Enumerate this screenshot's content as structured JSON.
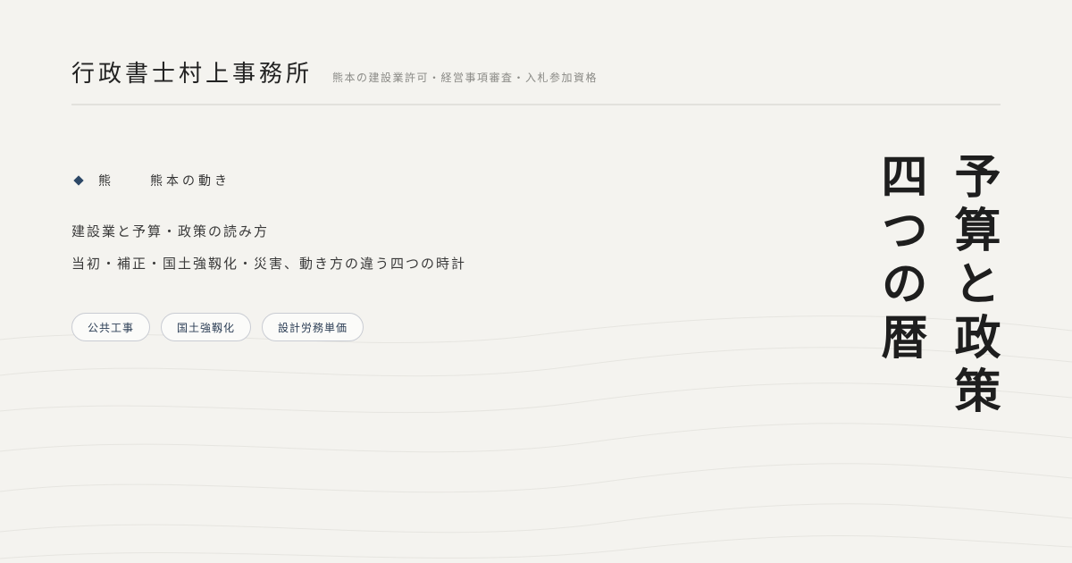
{
  "header": {
    "brand": "行政書士村上事務所",
    "tagline": "熊本の建設業許可・経営事項審査・入札参加資格"
  },
  "kicker": {
    "icon": "diamond-icon",
    "char": "熊",
    "label": "熊本の動き"
  },
  "subtitle_lines": [
    "建設業と予算・政策の読み方",
    "当初・補正・国土強靱化・災害、動き方の違う四つの時計"
  ],
  "tags": [
    "公共工事",
    "国土強靱化",
    "設計労務単価"
  ],
  "title_columns": [
    "予算と政策",
    "四つの暦"
  ],
  "colors": {
    "background": "#f4f3ef",
    "accent": "#2c4766",
    "text": "#222222"
  }
}
